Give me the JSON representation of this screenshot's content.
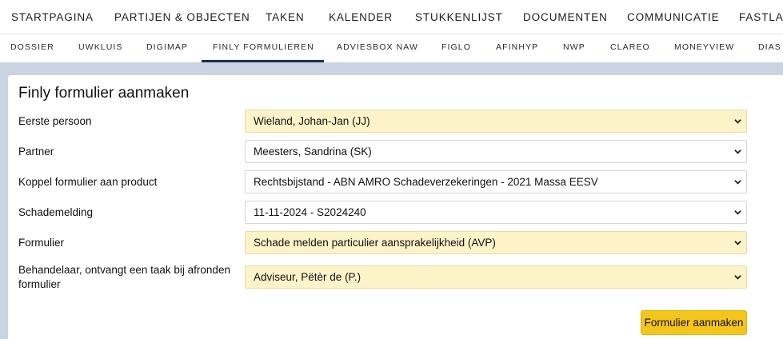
{
  "top_nav": {
    "items": [
      "STARTPAGINA",
      "PARTIJEN & OBJECTEN",
      "TAKEN",
      "KALENDER",
      "STUKKENLIJST",
      "DOCUMENTEN",
      "COMMUNICATIE",
      "FASTLAN"
    ]
  },
  "sub_nav": {
    "items": [
      "DOSSIER",
      "UWKLUIS",
      "DIGIMAP",
      "FINLY FORMULIEREN",
      "ADVIESBOX NAW",
      "FIGLO",
      "AFINHYP",
      "NWP",
      "CLAREO",
      "MONEYVIEW",
      "DIAS"
    ],
    "active": "FINLY FORMULIEREN",
    "active_color": "#1a2f4d"
  },
  "form": {
    "title": "Finly formulier aanmaken",
    "fields": [
      {
        "label": "Eerste persoon",
        "value": "Wieland, Johan-Jan (JJ)",
        "highlighted": true
      },
      {
        "label": "Partner",
        "value": "Meesters, Sandrina (SK)",
        "highlighted": false
      },
      {
        "label": "Koppel formulier aan product",
        "value": "Rechtsbijstand - ABN AMRO Schadeverzekeringen - 2021 Massa EESV",
        "highlighted": false
      },
      {
        "label": "Schademelding",
        "value": "11-11-2024 - S2024240",
        "highlighted": false
      },
      {
        "label": "Formulier",
        "value": "Schade melden particulier aansprakelijkheid (AVP)",
        "highlighted": true
      },
      {
        "label_line1": "Behandelaar, ontvangt een taak bij afronden",
        "label_line2": "formulier",
        "value": "Adviseur, Pëtèr de (P.)",
        "highlighted": true
      }
    ],
    "submit_label": "Formulier aanmaken"
  },
  "colors": {
    "highlight_field": "#fcf3c9",
    "submit_button": "#f4c51b",
    "workarea_background": "#c9d4e0"
  },
  "icons": {
    "select_arrow": "chevron-down-icon"
  }
}
